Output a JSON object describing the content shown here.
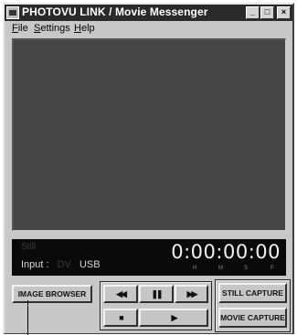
{
  "window": {
    "title": "PHOTOVU LINK / Movie Messenger",
    "controls": {
      "minimize": "_",
      "maximize": "□",
      "close": "×"
    }
  },
  "menu": {
    "file": "File",
    "settings": "Settings",
    "help": "Help"
  },
  "status": {
    "still_label": "Still",
    "input_label": "Input :",
    "input_dv": "DV",
    "input_usb": "USB",
    "timecode": "0:00:00:00",
    "unit_h": "H",
    "unit_m": "M",
    "unit_s": "S",
    "unit_f": "F"
  },
  "buttons": {
    "image_browser": "IMAGE BROWSER",
    "rewind": "◀◀",
    "pause": "❚❚",
    "fast_forward": "▶▶",
    "stop": "■",
    "play": "▶",
    "still_capture": "STILL CAPTURE",
    "movie_capture": "MOVIE CAPTURE"
  },
  "icons": {
    "app": "camera-icon",
    "pointer": "pointer-line"
  },
  "colors": {
    "titlebar": "#2a2a2a",
    "window_face": "#c8c8c8",
    "video_area": "#454545",
    "status_panel": "#0a0a0a"
  }
}
